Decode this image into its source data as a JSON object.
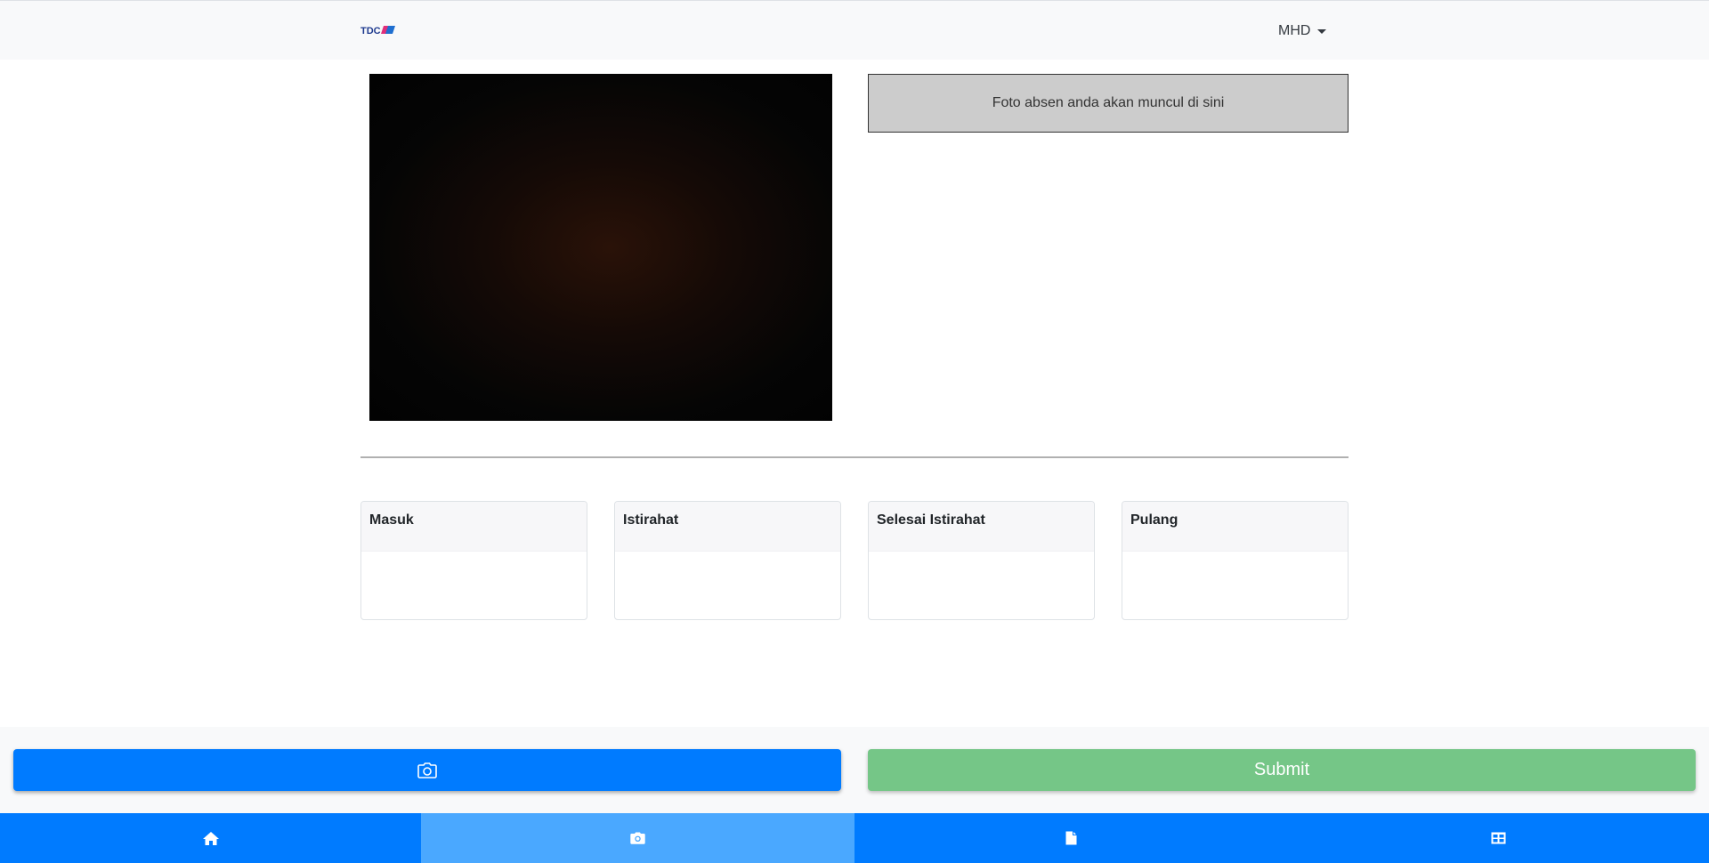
{
  "header": {
    "brand_logo": "TDC",
    "user_menu_label": "MHD",
    "user_menu_icon": "caret-down-icon"
  },
  "capture": {
    "photo_placeholder_text": "Foto absen anda akan muncul di sini"
  },
  "attendance_cards": [
    {
      "title": "Masuk"
    },
    {
      "title": "Istirahat"
    },
    {
      "title": "Selesai Istirahat"
    },
    {
      "title": "Pulang"
    }
  ],
  "actions": {
    "camera_button_icon": "camera-icon",
    "submit_label": "Submit"
  },
  "bottom_nav": {
    "items": [
      {
        "icon": "home-icon",
        "active": false
      },
      {
        "icon": "camera-icon",
        "active": true
      },
      {
        "icon": "file-icon",
        "active": false
      },
      {
        "icon": "table-icon",
        "active": false
      }
    ]
  },
  "colors": {
    "primary": "#007bff",
    "nav_active": "#4aa8ff",
    "submit_disabled": "#75c687",
    "placeholder_bg": "#cccccc"
  }
}
